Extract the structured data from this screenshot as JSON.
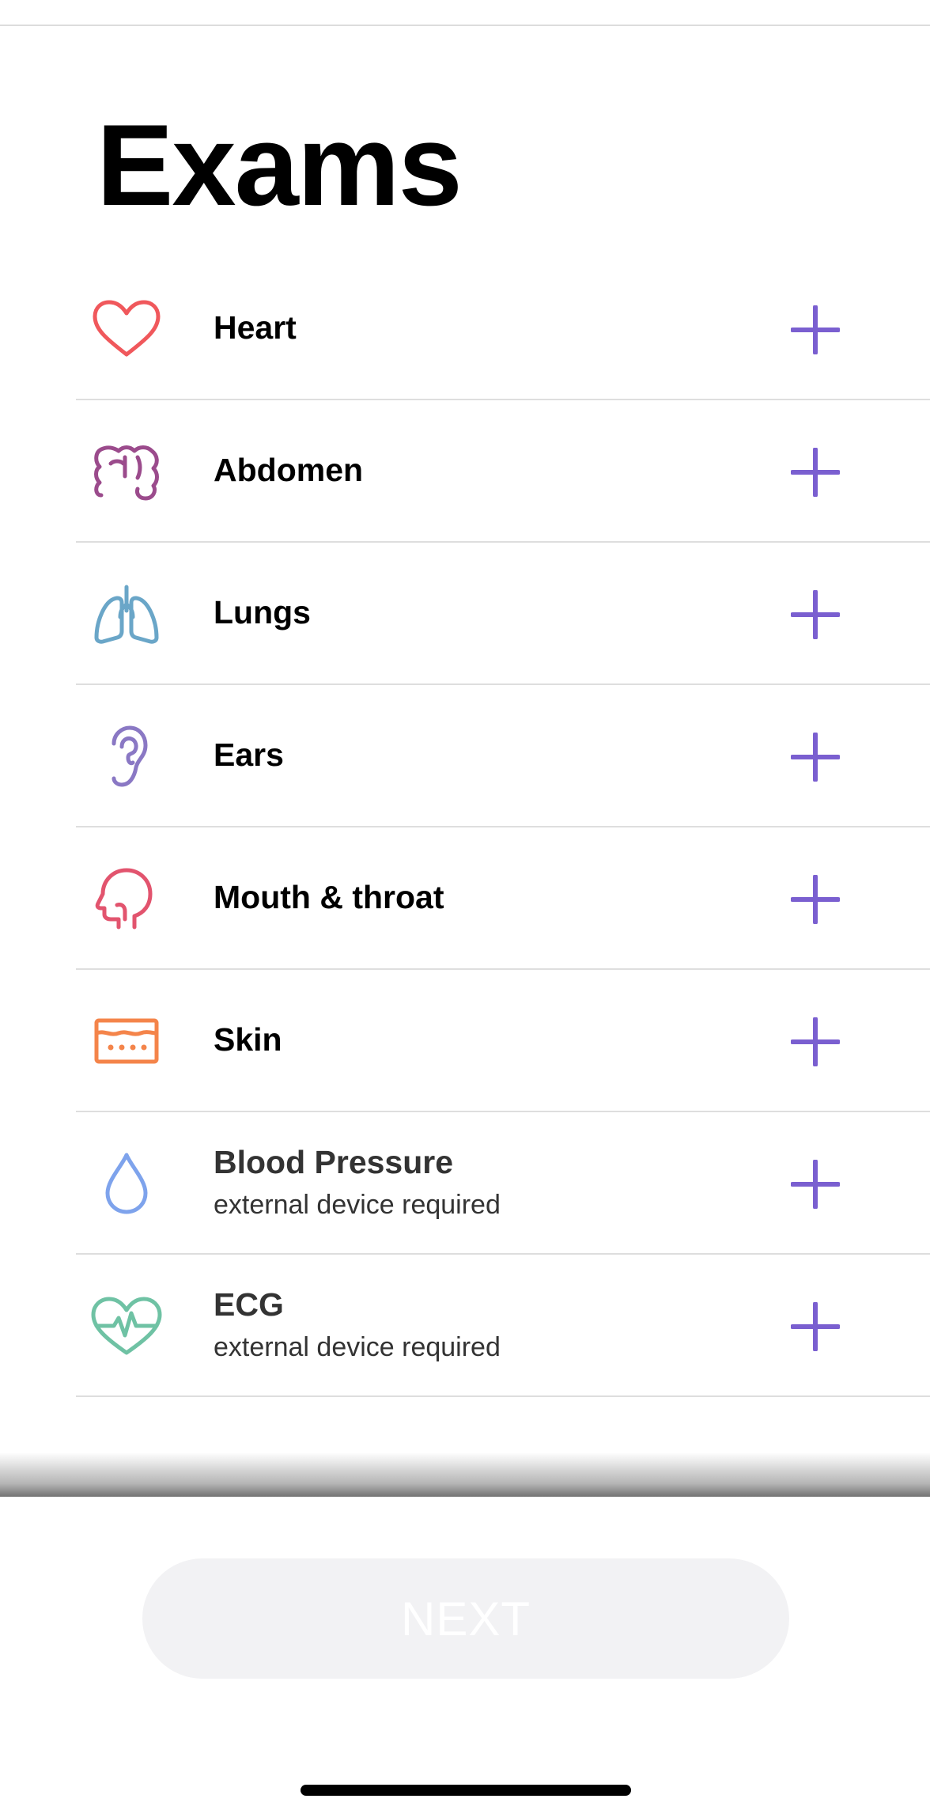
{
  "page": {
    "title": "Exams"
  },
  "colors": {
    "accent": "#7a5fd0",
    "heart": "#f0585c",
    "abdomen": "#9b4b8c",
    "lungs": "#6aa6c8",
    "ears": "#8a78c4",
    "mouth": "#e2546e",
    "skin": "#f4844a",
    "blood_pressure": "#7ea3ec",
    "ecg": "#6fc2a4"
  },
  "exams": [
    {
      "label": "Heart",
      "icon": "heart-icon"
    },
    {
      "label": "Abdomen",
      "icon": "intestine-icon"
    },
    {
      "label": "Lungs",
      "icon": "lungs-icon"
    },
    {
      "label": "Ears",
      "icon": "ear-icon"
    },
    {
      "label": "Mouth & throat",
      "icon": "head-profile-icon"
    },
    {
      "label": "Skin",
      "icon": "skin-layer-icon"
    },
    {
      "label": "Blood Pressure",
      "sub": "external device required",
      "icon": "drop-icon"
    },
    {
      "label": "ECG",
      "sub": "external device required",
      "icon": "heart-pulse-icon"
    }
  ],
  "footer": {
    "next_label": "NEXT"
  }
}
